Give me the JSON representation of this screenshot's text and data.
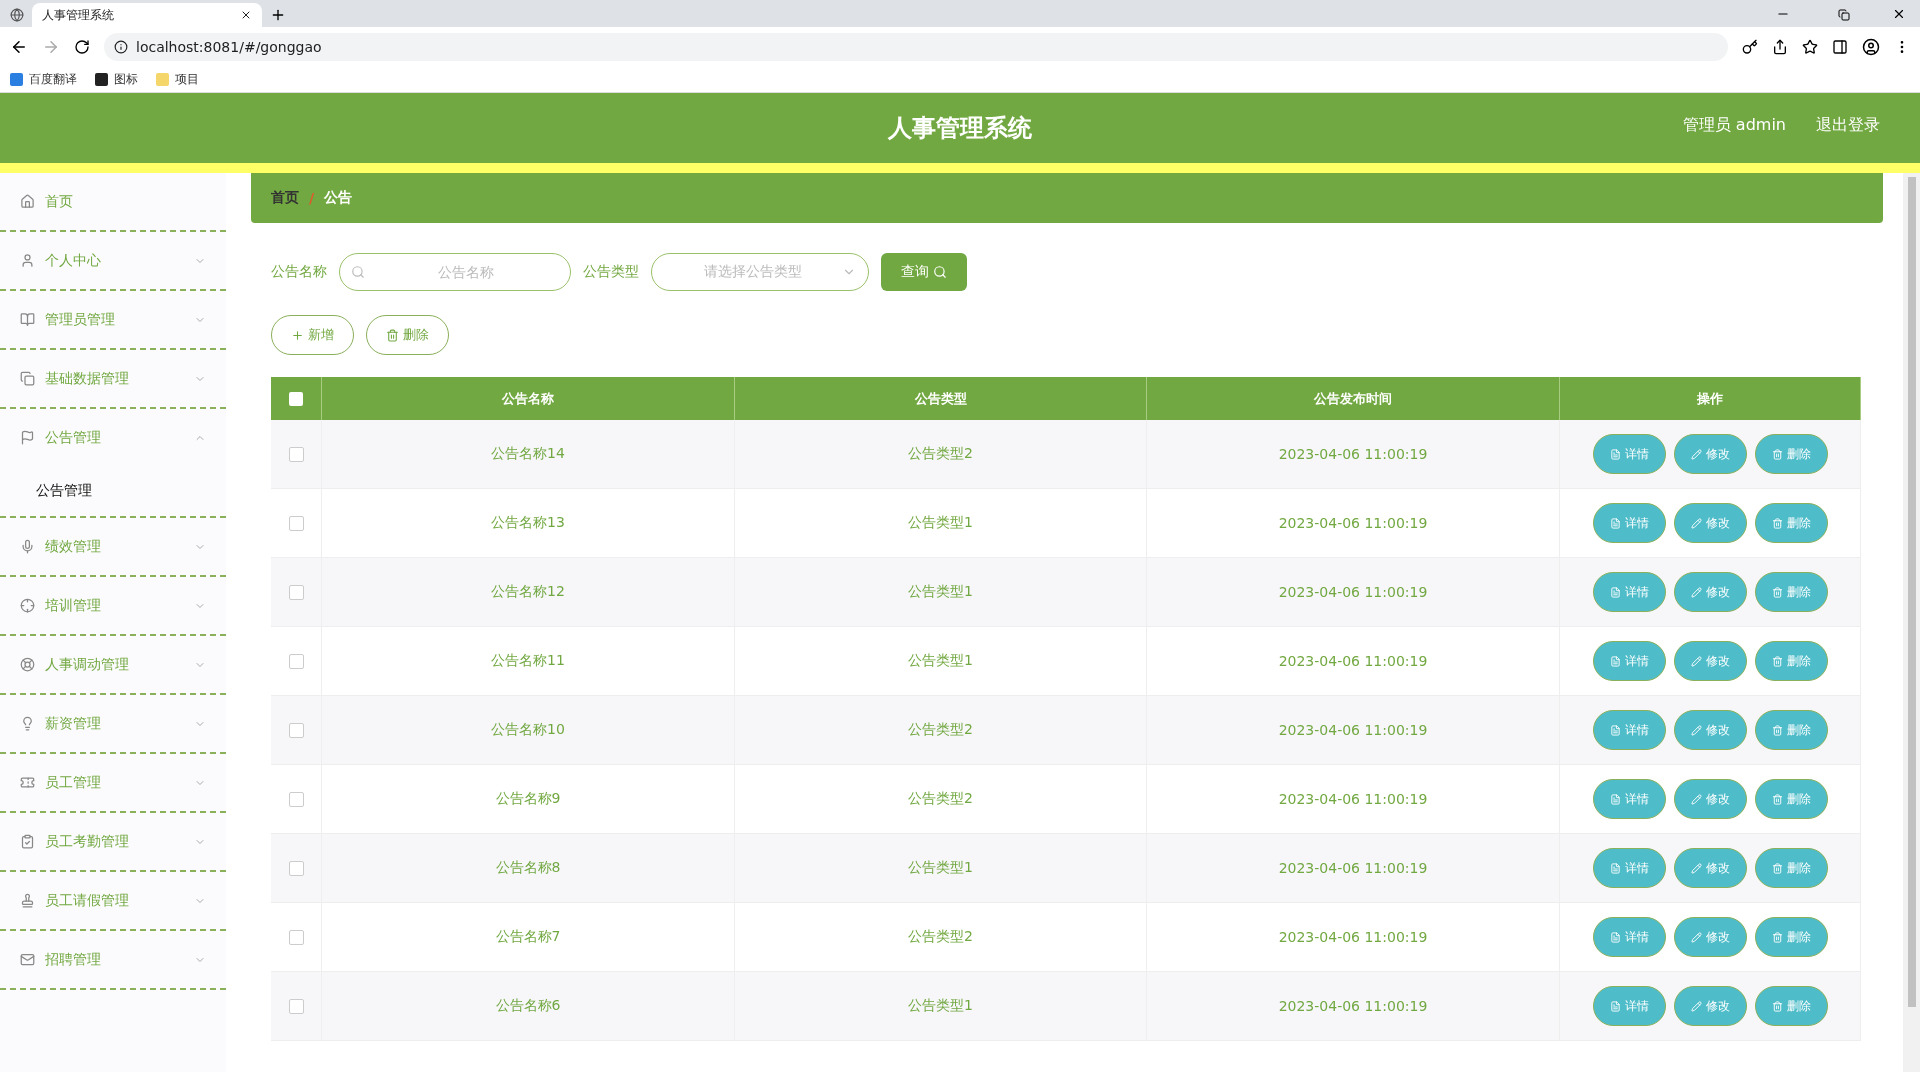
{
  "browser": {
    "tabs": [
      {
        "title": "人事管理系统",
        "selected": true
      }
    ],
    "url": "localhost:8081/#/gonggao",
    "bookmarks": [
      "百度翻译",
      "图标",
      "项目"
    ]
  },
  "header": {
    "title": "人事管理系统",
    "user": "管理员 admin",
    "logout": "退出登录"
  },
  "sidebar": {
    "items": [
      {
        "label": "首页"
      },
      {
        "label": "个人中心",
        "expanded": false
      },
      {
        "label": "管理员管理",
        "expanded": false
      },
      {
        "label": "基础数据管理",
        "expanded": false
      },
      {
        "label": "公告管理",
        "expanded": true,
        "children": [
          {
            "label": "公告管理",
            "selected": true
          }
        ]
      },
      {
        "label": "绩效管理",
        "expanded": false
      },
      {
        "label": "培训管理",
        "expanded": false
      },
      {
        "label": "人事调动管理",
        "expanded": false
      },
      {
        "label": "薪资管理",
        "expanded": false
      },
      {
        "label": "员工管理",
        "expanded": false
      },
      {
        "label": "员工考勤管理",
        "expanded": false
      },
      {
        "label": "员工请假管理",
        "expanded": false
      },
      {
        "label": "招聘管理",
        "expanded": false
      }
    ]
  },
  "breadcrumb": {
    "items": [
      "首页",
      "公告"
    ],
    "separator": "/"
  },
  "filters": {
    "name_label": "公告名称",
    "name_placeholder": "公告名称",
    "type_label": "公告类型",
    "type_placeholder": "请选择公告类型",
    "query": "查询"
  },
  "actions": [
    "新增",
    "删除"
  ],
  "table": {
    "select_all_checked": false,
    "columns": [
      "公告名称",
      "公告类型",
      "公告发布时间",
      "操作"
    ],
    "rows": [
      {
        "name": "公告名称14",
        "type": "公告类型2",
        "time": "2023-04-06 11:00:19",
        "checked": false,
        "actions": [
          "详情",
          "修改",
          "删除"
        ]
      },
      {
        "name": "公告名称13",
        "type": "公告类型1",
        "time": "2023-04-06 11:00:19",
        "checked": false,
        "actions": [
          "详情",
          "修改",
          "删除"
        ]
      },
      {
        "name": "公告名称12",
        "type": "公告类型1",
        "time": "2023-04-06 11:00:19",
        "checked": false,
        "actions": [
          "详情",
          "修改",
          "删除"
        ]
      },
      {
        "name": "公告名称11",
        "type": "公告类型1",
        "time": "2023-04-06 11:00:19",
        "checked": false,
        "actions": [
          "详情",
          "修改",
          "删除"
        ]
      },
      {
        "name": "公告名称10",
        "type": "公告类型2",
        "time": "2023-04-06 11:00:19",
        "checked": false,
        "actions": [
          "详情",
          "修改",
          "删除"
        ]
      },
      {
        "name": "公告名称9",
        "type": "公告类型2",
        "time": "2023-04-06 11:00:19",
        "checked": false,
        "actions": [
          "详情",
          "修改",
          "删除"
        ]
      },
      {
        "name": "公告名称8",
        "type": "公告类型1",
        "time": "2023-04-06 11:00:19",
        "checked": false,
        "actions": [
          "详情",
          "修改",
          "删除"
        ]
      },
      {
        "name": "公告名称7",
        "type": "公告类型2",
        "time": "2023-04-06 11:00:19",
        "checked": false,
        "actions": [
          "详情",
          "修改",
          "删除"
        ]
      },
      {
        "name": "公告名称6",
        "type": "公告类型1",
        "time": "2023-04-06 11:00:19",
        "checked": false,
        "actions": [
          "详情",
          "修改",
          "删除"
        ]
      }
    ]
  }
}
